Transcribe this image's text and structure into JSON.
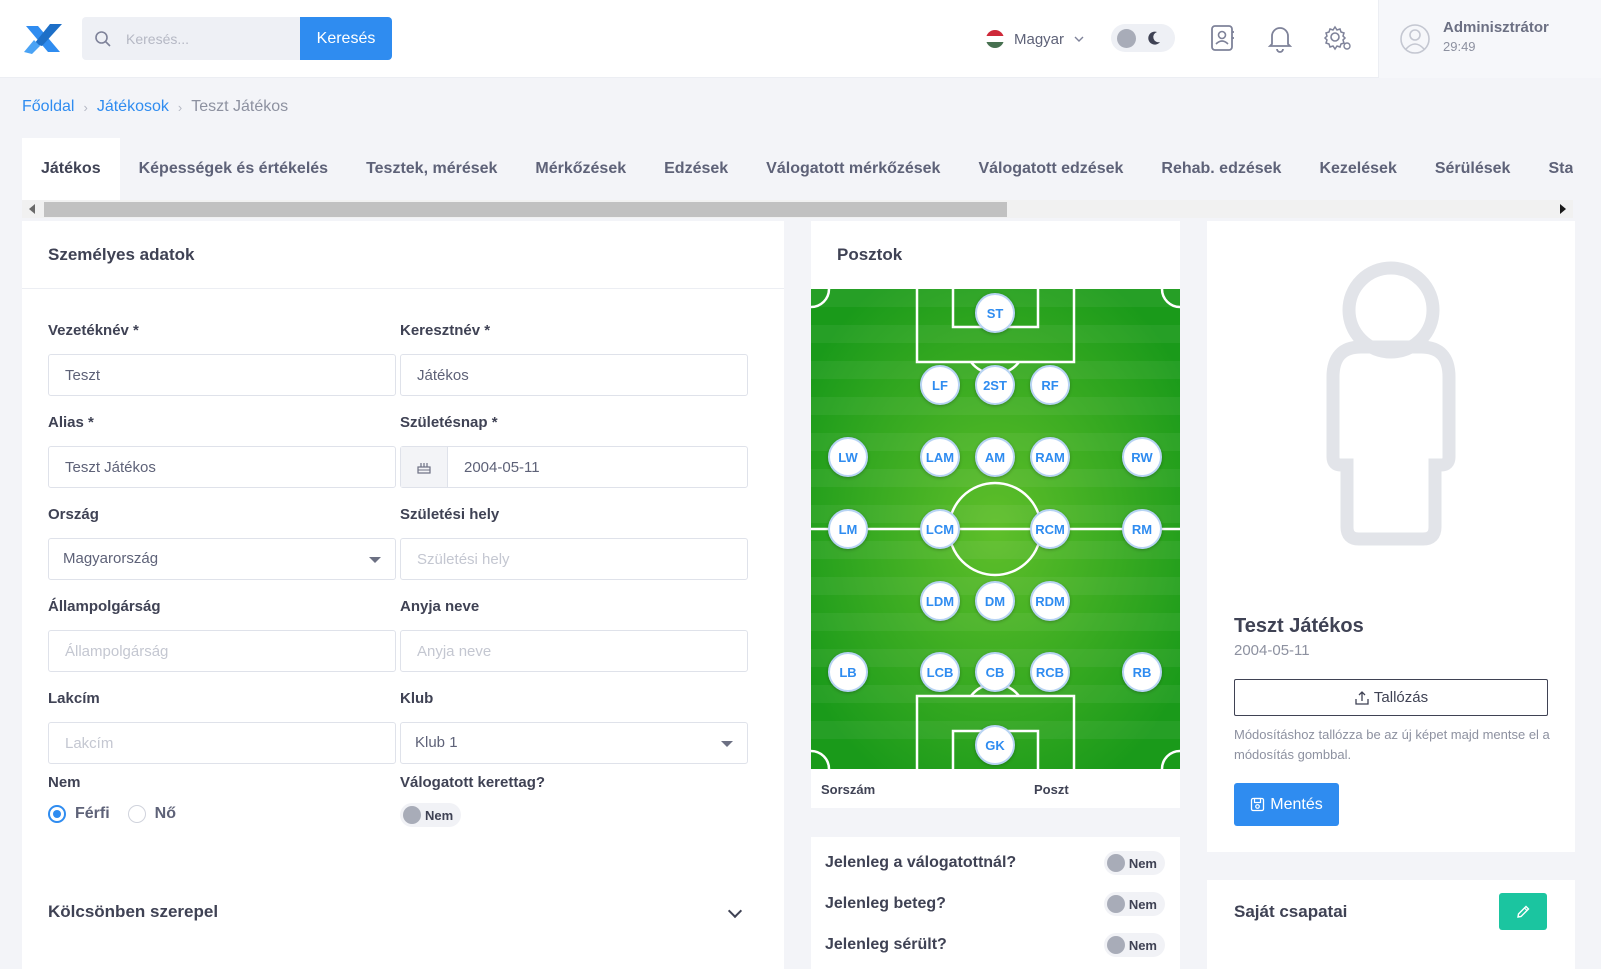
{
  "header": {
    "search_placeholder": "Keresés...",
    "search_button": "Keresés",
    "language": "Magyar",
    "user_name": "Adminisztrátor",
    "session_time": "29:49"
  },
  "breadcrumb": {
    "home": "Főoldal",
    "players": "Játékosok",
    "current": "Teszt Játékos"
  },
  "tabs": [
    "Játékos",
    "Képességek és értékelés",
    "Tesztek, mérések",
    "Mérkőzések",
    "Edzések",
    "Válogatott mérkőzések",
    "Válogatott edzések",
    "Rehab. edzések",
    "Kezelések",
    "Sérülések",
    "Statisztika"
  ],
  "personal": {
    "title": "Személyes adatok",
    "lastname_label": "Vezetéknév *",
    "lastname_value": "Teszt",
    "firstname_label": "Keresztnév *",
    "firstname_value": "Játékos",
    "alias_label": "Alias *",
    "alias_value": "Teszt Játékos",
    "birthdate_label": "Születésnap *",
    "birthdate_value": "2004-05-11",
    "country_label": "Ország",
    "country_value": "Magyarország",
    "birthplace_label": "Születési hely",
    "birthplace_placeholder": "Születési hely",
    "citizenship_label": "Állampolgárság",
    "citizenship_placeholder": "Állampolgárság",
    "mother_label": "Anyja neve",
    "mother_placeholder": "Anyja neve",
    "address_label": "Lakcím",
    "address_placeholder": "Lakcím",
    "club_label": "Klub",
    "club_value": "Klub 1",
    "gender_label": "Nem",
    "gender_male": "Férfi",
    "gender_female": "Nő",
    "national_label": "Válogatott kerettag?",
    "national_value": "Nem",
    "loan_label": "Kölcsönben szerepel"
  },
  "positions": {
    "title": "Posztok",
    "buttons": {
      "st": "ST",
      "lf": "LF",
      "2st": "2ST",
      "rf": "RF",
      "lw": "LW",
      "lam": "LAM",
      "am": "AM",
      "ram": "RAM",
      "rw": "RW",
      "lm": "LM",
      "lcm": "LCM",
      "rcm": "RCM",
      "rm": "RM",
      "ldm": "LDM",
      "dm": "DM",
      "rdm": "RDM",
      "lb": "LB",
      "lcb": "LCB",
      "cb": "CB",
      "rcb": "RCB",
      "rb": "RB",
      "gk": "GK"
    },
    "col_number": "Sorszám",
    "col_position": "Poszt"
  },
  "status": {
    "in_national": "Jelenleg a válogatottnál?",
    "sick": "Jelenleg beteg?",
    "injured": "Jelenleg sérült?",
    "value": "Nem"
  },
  "profile": {
    "name": "Teszt Játékos",
    "birthdate": "2004-05-11",
    "browse_label": "Tallózás",
    "hint": "Módosításhoz tallózza be az új képet majd mentse el a módosítás gombbal.",
    "save_label": "Mentés"
  },
  "teams": {
    "title": "Saját csapatai"
  },
  "colors": {
    "primary": "#2f8cf0",
    "success": "#1bc5a0",
    "pitch": "#2ea62e"
  }
}
